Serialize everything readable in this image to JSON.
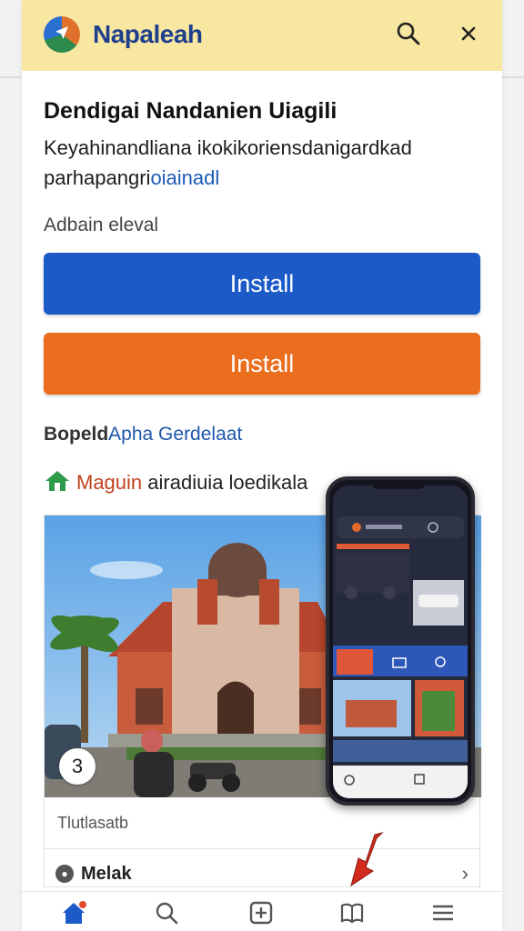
{
  "app_bar": {
    "app_name": "Napaleah",
    "search_icon": "search-icon",
    "close_icon": "close-icon"
  },
  "main": {
    "title": "Dendigai Nandanien Uiagili",
    "description_line1": "Keyahinandliana ikokikoriensdanigardkad",
    "description_line2_plain": "parhapangri",
    "description_line2_highlight": "oiainadl",
    "subheading": "Adbain eleval",
    "install_blue_label": "Install",
    "install_orange_label": "Install",
    "section_label_plain": "Bopeld",
    "section_label_accent": "Apha Gerdelaat",
    "feature_accent": "Maguin",
    "feature_rest": " airadiuia loedikala"
  },
  "card": {
    "badge_number": "3",
    "caption": "Tlutlasatb",
    "row_label": "Melak"
  },
  "bottom_nav": {
    "items": [
      "home-icon",
      "search-icon",
      "add-icon",
      "book-icon",
      "menu-icon"
    ]
  },
  "colors": {
    "app_bar": "#f7e7a1",
    "primary_blue": "#1c5ac8",
    "accent_orange": "#ea6e1e",
    "nav_active": "#1c5ac8"
  }
}
